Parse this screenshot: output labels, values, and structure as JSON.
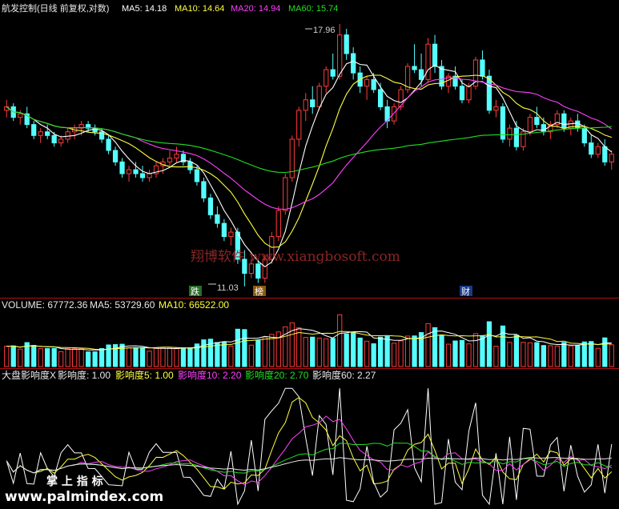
{
  "header": {
    "title": "航发控制(日线 前复权,对数)",
    "ma5": "MA5: 14.18",
    "ma10": "MA10: 14.64",
    "ma20": "MA20: 14.94",
    "ma60": "MA60: 15.74"
  },
  "annotations": {
    "high": "17.96",
    "low": "11.03",
    "tag_die": "跌",
    "tag_bang": "榜",
    "tag_cai": "财"
  },
  "watermarks": {
    "center": "翔博软件 www.xiangbosoft.com",
    "corner_cn": "掌 上 指 标",
    "corner_url": "www.palmindex.com"
  },
  "volume_header": {
    "volume": "VOLUME: 67772.36",
    "ma5": "MA5: 53729.60",
    "ma10": "MA10: 66522.00"
  },
  "indicator_header": {
    "name": "大盘影响度X",
    "v0": "影响度: 1.00",
    "v5": "影响度5: 1.00",
    "v10": "影响度10: 2.20",
    "v20": "影响度20: 2.70",
    "v60": "影响度60: 2.27"
  },
  "colors": {
    "up": "#ff3b3b",
    "down": "#54ffff",
    "ma5": "#ffffff",
    "ma10": "#ffff40",
    "ma20": "#ff40ff",
    "ma60": "#20e020",
    "separator": "#b01010"
  },
  "chart_data": {
    "type": "candlestick",
    "price_scale": "log",
    "price_range": [
      11.03,
      17.96
    ],
    "ohlc": [
      [
        15.3,
        15.6,
        15.1,
        15.4
      ],
      [
        15.4,
        15.5,
        15.0,
        15.1
      ],
      [
        15.1,
        15.3,
        14.9,
        15.2
      ],
      [
        15.2,
        15.4,
        14.8,
        14.9
      ],
      [
        14.9,
        15.0,
        14.5,
        14.6
      ],
      [
        14.6,
        14.8,
        14.4,
        14.7
      ],
      [
        14.7,
        14.9,
        14.5,
        14.6
      ],
      [
        14.6,
        14.7,
        14.3,
        14.4
      ],
      [
        14.4,
        14.6,
        14.3,
        14.5
      ],
      [
        14.5,
        14.8,
        14.4,
        14.7
      ],
      [
        14.7,
        14.9,
        14.5,
        14.8
      ],
      [
        14.8,
        15.0,
        14.6,
        14.9
      ],
      [
        14.9,
        15.0,
        14.7,
        14.8
      ],
      [
        14.8,
        14.9,
        14.6,
        14.7
      ],
      [
        14.7,
        14.8,
        14.4,
        14.5
      ],
      [
        14.5,
        14.6,
        14.1,
        14.2
      ],
      [
        14.2,
        14.3,
        13.8,
        13.9
      ],
      [
        13.9,
        14.0,
        13.5,
        13.6
      ],
      [
        13.6,
        13.8,
        13.4,
        13.7
      ],
      [
        13.7,
        13.9,
        13.5,
        13.6
      ],
      [
        13.6,
        13.8,
        13.4,
        13.5
      ],
      [
        13.5,
        13.7,
        13.4,
        13.6
      ],
      [
        13.6,
        13.9,
        13.5,
        13.8
      ],
      [
        13.8,
        14.0,
        13.6,
        13.9
      ],
      [
        13.9,
        14.2,
        13.8,
        14.0
      ],
      [
        14.0,
        14.3,
        13.9,
        14.1
      ],
      [
        14.1,
        14.2,
        13.8,
        13.9
      ],
      [
        13.9,
        14.0,
        13.6,
        13.7
      ],
      [
        13.7,
        13.8,
        13.3,
        13.4
      ],
      [
        13.4,
        13.5,
        12.9,
        13.0
      ],
      [
        13.0,
        13.1,
        12.5,
        12.6
      ],
      [
        12.6,
        12.8,
        12.3,
        12.4
      ],
      [
        12.4,
        12.5,
        12.0,
        12.1
      ],
      [
        12.1,
        12.3,
        11.9,
        12.2
      ],
      [
        12.2,
        12.3,
        11.5,
        11.6
      ],
      [
        11.6,
        11.8,
        11.03,
        11.3
      ],
      [
        11.3,
        11.6,
        11.2,
        11.5
      ],
      [
        11.5,
        11.6,
        11.1,
        11.2
      ],
      [
        11.2,
        11.7,
        11.1,
        11.6
      ],
      [
        11.6,
        12.2,
        11.5,
        12.1
      ],
      [
        12.1,
        12.8,
        12.0,
        12.7
      ],
      [
        12.7,
        13.6,
        12.6,
        13.5
      ],
      [
        13.5,
        14.6,
        13.4,
        14.5
      ],
      [
        14.5,
        15.4,
        14.3,
        15.3
      ],
      [
        15.3,
        15.8,
        15.0,
        15.6
      ],
      [
        15.6,
        16.0,
        15.2,
        15.4
      ],
      [
        15.4,
        16.1,
        15.3,
        16.0
      ],
      [
        16.0,
        16.6,
        15.8,
        16.5
      ],
      [
        16.5,
        17.0,
        16.2,
        16.3
      ],
      [
        16.3,
        17.96,
        16.2,
        17.6
      ],
      [
        17.6,
        17.8,
        16.8,
        17.0
      ],
      [
        17.0,
        17.2,
        16.2,
        16.4
      ],
      [
        16.4,
        16.6,
        15.8,
        16.0
      ],
      [
        16.0,
        16.3,
        15.6,
        16.2
      ],
      [
        16.2,
        16.4,
        15.8,
        15.9
      ],
      [
        15.9,
        16.1,
        15.3,
        15.4
      ],
      [
        15.4,
        15.6,
        14.8,
        15.0
      ],
      [
        15.0,
        15.5,
        14.9,
        15.4
      ],
      [
        15.4,
        16.0,
        15.3,
        15.9
      ],
      [
        15.9,
        16.7,
        15.8,
        16.6
      ],
      [
        16.6,
        17.3,
        16.4,
        16.5
      ],
      [
        16.5,
        17.0,
        16.0,
        16.2
      ],
      [
        16.2,
        17.5,
        16.1,
        17.3
      ],
      [
        17.3,
        17.6,
        16.4,
        16.6
      ],
      [
        16.6,
        16.8,
        15.9,
        16.0
      ],
      [
        16.0,
        16.4,
        15.8,
        16.3
      ],
      [
        16.3,
        16.6,
        15.9,
        16.0
      ],
      [
        16.0,
        16.2,
        15.5,
        15.6
      ],
      [
        15.6,
        16.1,
        15.5,
        16.0
      ],
      [
        16.0,
        16.9,
        15.9,
        16.8
      ],
      [
        16.8,
        17.1,
        16.2,
        16.3
      ],
      [
        16.3,
        16.5,
        15.2,
        15.3
      ],
      [
        15.3,
        15.6,
        15.1,
        15.4
      ],
      [
        15.4,
        15.5,
        14.4,
        14.5
      ],
      [
        14.5,
        14.9,
        14.3,
        14.8
      ],
      [
        14.8,
        15.0,
        14.2,
        14.3
      ],
      [
        14.3,
        14.8,
        14.2,
        14.7
      ],
      [
        14.7,
        15.2,
        14.6,
        15.1
      ],
      [
        15.1,
        15.4,
        14.8,
        14.9
      ],
      [
        14.9,
        15.1,
        14.6,
        14.7
      ],
      [
        14.7,
        15.0,
        14.5,
        14.9
      ],
      [
        14.9,
        15.3,
        14.8,
        15.2
      ],
      [
        15.2,
        15.3,
        14.7,
        14.8
      ],
      [
        14.8,
        15.1,
        14.6,
        15.0
      ],
      [
        15.0,
        15.2,
        14.7,
        14.8
      ],
      [
        14.8,
        14.9,
        14.3,
        14.4
      ],
      [
        14.4,
        14.6,
        14.0,
        14.1
      ],
      [
        14.1,
        14.4,
        14.0,
        14.3
      ],
      [
        14.3,
        14.5,
        13.8,
        13.9
      ],
      [
        13.9,
        14.2,
        13.7,
        14.1
      ]
    ],
    "volume_range": [
      0,
      220000
    ]
  }
}
